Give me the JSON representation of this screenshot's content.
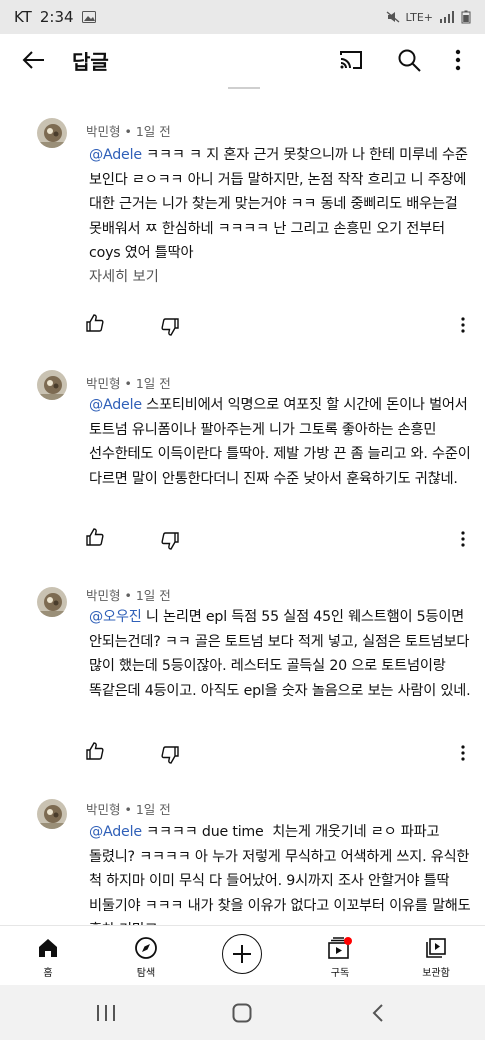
{
  "status_bar": {
    "carrier": "KT",
    "time": "2:34",
    "right_text": "LTE+"
  },
  "app_bar": {
    "title": "답글"
  },
  "comments": [
    {
      "author": "박민형",
      "time": "1일 전",
      "mention": "@Adele",
      "text": " ㅋㅋㅋ ㅋ 지 혼자 근거 못찾으니까 나 한테 미루네 수준 보인다 ㄹㅇㅋㅋ 아니 거듭 말하지만, 논점 작작 흐리고 니 주장에 대한 근거는 니가 찾는게 맞는거야 ㅋㅋ 동네 중삐리도 배우는걸 못배워서 ㅉ 한심하네 ㅋㅋㅋㅋ 난 그리고 손흥민 오기 전부터 coys 였어 틀딱아",
      "read_more": "자세히 보기"
    },
    {
      "author": "박민형",
      "time": "1일 전",
      "mention": "@Adele",
      "text": " 스포티비에서 익명으로 여포짓 할 시간에 돈이나 벌어서 토트넘 유니폼이나 팔아주는게 니가 그토록 좋아하는 손흥민 선수한테도 이득이란다 틀딱아. 제발 가방 끈 좀 늘리고 와. 수준이 다르면 말이 안통한다더니 진짜 수준 낮아서 훈육하기도 귀찮네."
    },
    {
      "author": "박민형",
      "time": "1일 전",
      "mention": "@오우진",
      "text": " 니 논리면 epl 득점 55 실점 45인 웨스트햄이 5등이면 안되는건데? ㅋㅋ 골은 토트넘 보다 적게 넣고, 실점은 토트넘보다 많이 했는데 5등이잖아. 레스터도 골득실 20 으로 토트넘이랑 똑같은데 4등이고. 아직도 epl을 숫자 놀음으로 보는 사람이 있네."
    },
    {
      "author": "박민형",
      "time": "1일 전",
      "mention": "@Adele",
      "text": " ㅋㅋㅋㅋ due time  치는게 개웃기네 ㄹㅇ 파파고 돌렸니? ㅋㅋㅋㅋ 아 누가 저렇게 무식하고 어색하게 쓰지. 유식한 척 하지마 이미 무식 다 들어났어. 9시까지 조사 안할거야 틀딱 비둘기야 ㅋㅋㅋ 내가 찾을 이유가 없다고 이꼬부터 이유를 말해도 홍차 기막고"
    }
  ],
  "bottom_nav": [
    {
      "label": "홈",
      "icon": "home-icon"
    },
    {
      "label": "탐색",
      "icon": "compass-icon"
    },
    {
      "label": "",
      "icon": "create-icon"
    },
    {
      "label": "구독",
      "icon": "subscriptions-icon"
    },
    {
      "label": "보관함",
      "icon": "library-icon"
    }
  ],
  "colors": {
    "mention": "#3060b8",
    "badge": "#ff0000",
    "status_bar_bg": "#e9e9e9"
  }
}
